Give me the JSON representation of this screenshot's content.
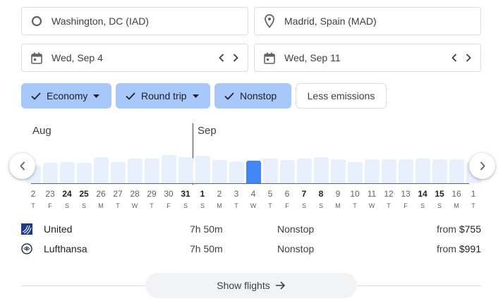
{
  "search": {
    "origin": "Washington, DC (IAD)",
    "destination": "Madrid, Spain (MAD)",
    "depart_date": "Wed, Sep 4",
    "return_date": "Wed, Sep 11"
  },
  "filters": {
    "economy": "Economy",
    "trip_type": "Round trip",
    "nonstop": "Nonstop",
    "less_emissions": "Less emissions"
  },
  "calendar": {
    "month_left": "Aug",
    "month_right": "Sep",
    "selected_index": 13,
    "days": [
      {
        "n": "2",
        "d": "T",
        "b": false,
        "v": 0.62
      },
      {
        "n": "23",
        "d": "F",
        "b": false,
        "v": 0.72
      },
      {
        "n": "24",
        "d": "S",
        "b": true,
        "v": 0.75
      },
      {
        "n": "25",
        "d": "S",
        "b": true,
        "v": 0.72
      },
      {
        "n": "26",
        "d": "M",
        "b": false,
        "v": 0.92
      },
      {
        "n": "27",
        "d": "T",
        "b": false,
        "v": 0.75
      },
      {
        "n": "28",
        "d": "W",
        "b": false,
        "v": 0.88
      },
      {
        "n": "29",
        "d": "T",
        "b": false,
        "v": 0.88
      },
      {
        "n": "30",
        "d": "F",
        "b": false,
        "v": 1.0
      },
      {
        "n": "31",
        "d": "S",
        "b": true,
        "v": 0.92
      },
      {
        "n": "1",
        "d": "S",
        "b": true,
        "v": 0.97
      },
      {
        "n": "2",
        "d": "M",
        "b": false,
        "v": 0.82
      },
      {
        "n": "3",
        "d": "T",
        "b": false,
        "v": 0.78
      },
      {
        "n": "4",
        "d": "W",
        "b": false,
        "v": 0.8
      },
      {
        "n": "5",
        "d": "T",
        "b": false,
        "v": 0.88
      },
      {
        "n": "6",
        "d": "F",
        "b": false,
        "v": 0.82
      },
      {
        "n": "7",
        "d": "S",
        "b": true,
        "v": 0.88
      },
      {
        "n": "8",
        "d": "S",
        "b": true,
        "v": 0.92
      },
      {
        "n": "9",
        "d": "M",
        "b": false,
        "v": 0.85
      },
      {
        "n": "10",
        "d": "T",
        "b": false,
        "v": 0.75
      },
      {
        "n": "11",
        "d": "W",
        "b": false,
        "v": 0.85
      },
      {
        "n": "12",
        "d": "T",
        "b": false,
        "v": 0.85
      },
      {
        "n": "13",
        "d": "F",
        "b": false,
        "v": 0.85
      },
      {
        "n": "14",
        "d": "S",
        "b": true,
        "v": 0.88
      },
      {
        "n": "15",
        "d": "S",
        "b": true,
        "v": 0.85
      },
      {
        "n": "16",
        "d": "M",
        "b": false,
        "v": 0.85
      },
      {
        "n": "1",
        "d": "T",
        "b": false,
        "v": 0.75
      }
    ]
  },
  "results": [
    {
      "airline": "United",
      "duration": "7h 50m",
      "stops": "Nonstop",
      "price_prefix": "from",
      "price": "$755",
      "icon": "united-logo-icon",
      "color": "#1a3a8f"
    },
    {
      "airline": "Lufthansa",
      "duration": "7h 50m",
      "stops": "Nonstop",
      "price_prefix": "from",
      "price": "$991",
      "icon": "lufthansa-logo-icon",
      "color": "#05164d"
    }
  ],
  "show_flights": "Show flights",
  "colors": {
    "selected_chip": "#a8c7fa",
    "bar": "#e8f0fe",
    "bar_selected": "#4285f4"
  }
}
